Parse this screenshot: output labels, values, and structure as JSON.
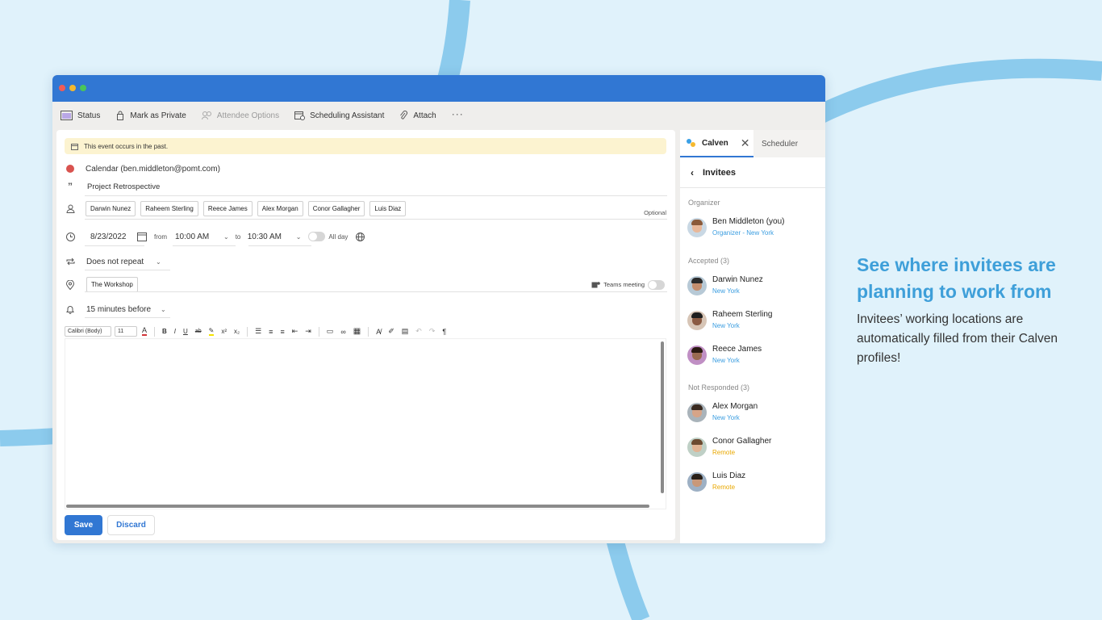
{
  "toolbar": {
    "status": "Status",
    "mark_private": "Mark as Private",
    "attendee_options": "Attendee Options",
    "scheduling_assistant": "Scheduling Assistant",
    "attach": "Attach",
    "more": "···"
  },
  "event": {
    "banner": "This event occurs in the past.",
    "calendar": "Calendar (ben.middleton@pomt.com)",
    "title": "Project Retrospective",
    "attendees": [
      "Darwin Nunez",
      "Raheem Sterling",
      "Reece James",
      "Alex Morgan",
      "Conor Gallagher",
      "Luis Diaz"
    ],
    "optional_label": "Optional",
    "date": "8/23/2022",
    "from_label": "from",
    "start_time": "10:00 AM",
    "to_label": "to",
    "end_time": "10:30 AM",
    "all_day_label": "All day",
    "repeat": "Does not repeat",
    "location": "The Workshop",
    "teams_label": "Teams meeting",
    "reminder": "15 minutes before"
  },
  "editor": {
    "font": "Calibri (Body)",
    "size": "11"
  },
  "actions": {
    "save": "Save",
    "discard": "Discard"
  },
  "pane": {
    "tab_active": "Calven",
    "tab_other": "Scheduler",
    "heading": "Invitees",
    "organizer_label": "Organizer",
    "organizer": {
      "name": "Ben Middleton (you)",
      "location": "Organizer - New York"
    },
    "accepted_label": "Accepted (3)",
    "accepted": [
      {
        "name": "Darwin Nunez",
        "location": "New York"
      },
      {
        "name": "Raheem Sterling",
        "location": "New York"
      },
      {
        "name": "Reece James",
        "location": "New York"
      }
    ],
    "not_responded_label": "Not Responded (3)",
    "not_responded": [
      {
        "name": "Alex Morgan",
        "location": "New York"
      },
      {
        "name": "Conor Gallagher",
        "location": "Remote"
      },
      {
        "name": "Luis Diaz",
        "location": "Remote"
      }
    ]
  },
  "promo": {
    "headline": "See where invitees are planning to work from",
    "body": "Invitees’ working locations are automatically filled from their Calven profiles!"
  },
  "colors": {
    "accent": "#3177d3",
    "background": "#e0f2fb",
    "location_office": "#3a9de0",
    "location_remote": "#e9a800",
    "headline": "#3e9fd9"
  }
}
